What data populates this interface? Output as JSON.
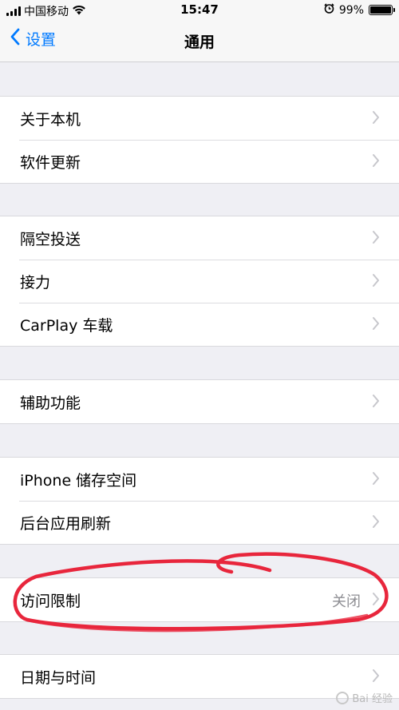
{
  "status_bar": {
    "carrier": "中国移动",
    "time": "15:47",
    "battery_percent": "99%",
    "battery_level": 0.99,
    "icons": [
      "signal-icon",
      "wifi-icon",
      "alarm-icon",
      "battery-icon"
    ]
  },
  "nav": {
    "back_label": "设置",
    "title": "通用"
  },
  "groups": [
    {
      "rows": [
        {
          "label": "关于本机"
        },
        {
          "label": "软件更新"
        }
      ]
    },
    {
      "rows": [
        {
          "label": "隔空投送"
        },
        {
          "label": "接力"
        },
        {
          "label": "CarPlay 车载"
        }
      ]
    },
    {
      "rows": [
        {
          "label": "辅助功能"
        }
      ]
    },
    {
      "rows": [
        {
          "label": "iPhone 储存空间"
        },
        {
          "label": "后台应用刷新"
        }
      ]
    },
    {
      "rows": [
        {
          "label": "访问限制",
          "value": "关闭"
        }
      ]
    },
    {
      "rows": [
        {
          "label": "日期与时间"
        }
      ]
    }
  ],
  "annotation": {
    "color": "#e8263c",
    "target": "访问限制"
  },
  "watermark": "Bai 经验",
  "colors": {
    "accent": "#007aff",
    "background": "#efeff4",
    "chevron": "#c7c7cc"
  }
}
